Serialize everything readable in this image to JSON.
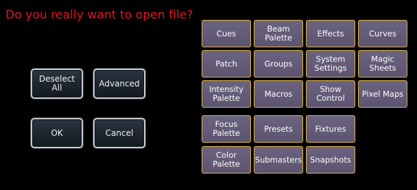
{
  "dialog": {
    "question": "Do you really want to open file?"
  },
  "left_buttons": {
    "deselect_all": "Deselect\nAll",
    "advanced": "Advanced",
    "ok": "OK",
    "cancel": "Cancel"
  },
  "tiles": [
    "Cues",
    "Beam Palette",
    "Effects",
    "Curves",
    "Patch",
    "Groups",
    "System Settings",
    "Magic Sheets",
    "Intensity Palette",
    "Macros",
    "Show Control",
    "Pixel Maps",
    "Focus Palette",
    "Presets",
    "Fixtures",
    "Color Palette",
    "Submasters",
    "Snapshots"
  ],
  "colors": {
    "question_text": "#e8141e",
    "tile_bg": "#645c78",
    "tile_border": "#e2b640",
    "button_border": "#c8cdd2"
  }
}
